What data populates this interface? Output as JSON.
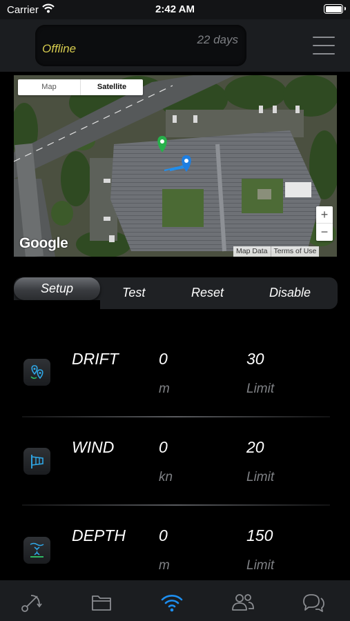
{
  "status_bar": {
    "carrier": "Carrier",
    "time": "2:42 AM"
  },
  "header": {
    "status": "Offline",
    "days": "22 days",
    "menu_icon": "hamburger-menu-icon"
  },
  "map": {
    "type_options": [
      "Map",
      "Satellite"
    ],
    "selected_type": "Satellite",
    "provider_logo": "Google",
    "zoom_in": "+",
    "zoom_out": "−",
    "attribution": [
      "Map Data",
      "Terms of Use"
    ]
  },
  "segments": {
    "active": "Setup",
    "items": [
      "Test",
      "Reset",
      "Disable"
    ]
  },
  "alarms": [
    {
      "name": "DRIFT",
      "value": "0",
      "unit": "m",
      "limit": "30",
      "limit_label": "Limit",
      "icon": "drift-pins-icon"
    },
    {
      "name": "WIND",
      "value": "0",
      "unit": "kn",
      "limit": "20",
      "limit_label": "Limit",
      "icon": "windsock-icon"
    },
    {
      "name": "DEPTH",
      "value": "0",
      "unit": "m",
      "limit": "150",
      "limit_label": "Limit",
      "icon": "depth-icon"
    }
  ],
  "tabbar": {
    "items": [
      "route-icon",
      "folder-icon",
      "wifi-alarm-icon",
      "people-icon",
      "chat-icon"
    ],
    "active": "wifi-alarm-icon",
    "accent_color": "#1e8ff0"
  }
}
